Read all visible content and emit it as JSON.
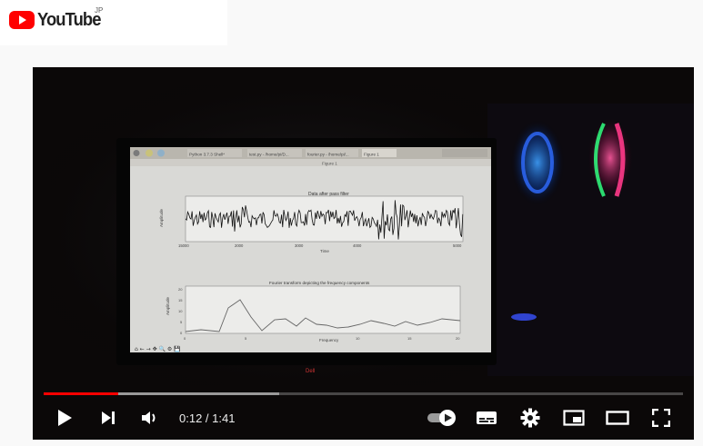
{
  "brand": {
    "name": "YouTube",
    "region": "JP",
    "logo_color": "#ff0000"
  },
  "player": {
    "current_time": "0:12",
    "separator": " / ",
    "duration": "1:41",
    "played_fraction": 0.116,
    "buffered_fraction": 0.368
  },
  "video_frame": {
    "screen_app": {
      "tabs": [
        "Python 3.7.3 Shell*",
        "test.py - /home/pi/D...",
        "fourier.py - /home/pi/...",
        "Figure 1"
      ],
      "window_title": "Figure 1",
      "plot1_title": "Data after pass filter",
      "plot1_ylabel": "Amplitude",
      "plot1_xlabel": "Time",
      "plot1_xticks": [
        "15000",
        "2000",
        "3000",
        "4000",
        "5000"
      ],
      "plot2_title": "Fourier transform depicting the frequency components",
      "plot2_ylabel": "Amplitude",
      "plot2_xlabel": "Frequency",
      "plot2_yticks": [
        "20",
        "15",
        "10",
        "5",
        "0"
      ],
      "plot2_xticks": [
        "0",
        "5",
        "10",
        "15",
        "20"
      ],
      "monitor_brand": "Dell"
    }
  },
  "controls": {
    "play_icon": "play-icon",
    "next_icon": "next-icon",
    "volume_icon": "volume-icon",
    "autoplay_icon": "autoplay-toggle-icon",
    "subtitles_icon": "subtitles-icon",
    "settings_icon": "gear-icon",
    "miniplayer_icon": "miniplayer-icon",
    "theater_icon": "theater-icon",
    "fullscreen_icon": "fullscreen-icon"
  }
}
